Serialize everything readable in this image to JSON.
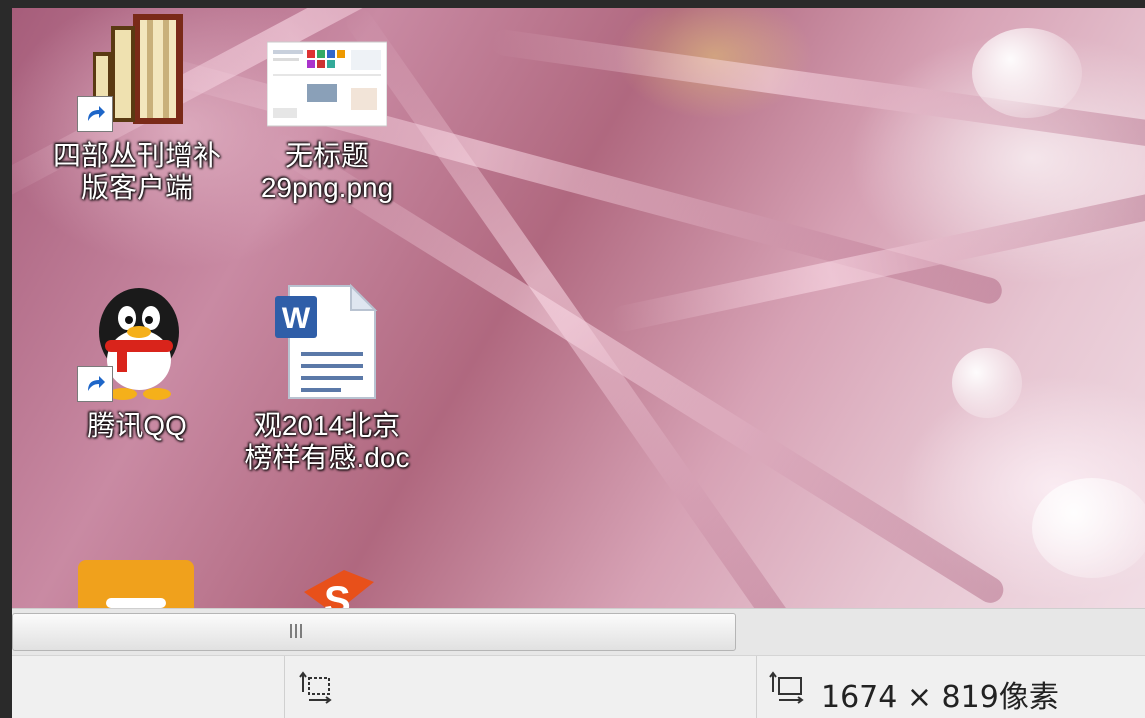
{
  "desktop": {
    "icons": [
      {
        "name": "sibu-client",
        "label_line1": "四部丛刊增补",
        "label_line2": "版客户端",
        "shortcut": true
      },
      {
        "name": "untitled-image",
        "label_line1": "无标题",
        "label_line2": "29png.png",
        "shortcut": false
      },
      {
        "name": "tencent-qq",
        "label_line1": "腾讯QQ",
        "label_line2": "",
        "shortcut": true
      },
      {
        "name": "word-doc",
        "label_line1": "观2014北京",
        "label_line2": "榜样有感.doc",
        "shortcut": false
      }
    ]
  },
  "statusbar": {
    "selection_text": "",
    "image_size": "1674 × 819像素"
  },
  "colors": {
    "viewer_bg": "#2a2a2a",
    "statusbar_bg": "#f0f0f0",
    "word_blue": "#2f5ea8",
    "qq_red": "#d9241b"
  }
}
